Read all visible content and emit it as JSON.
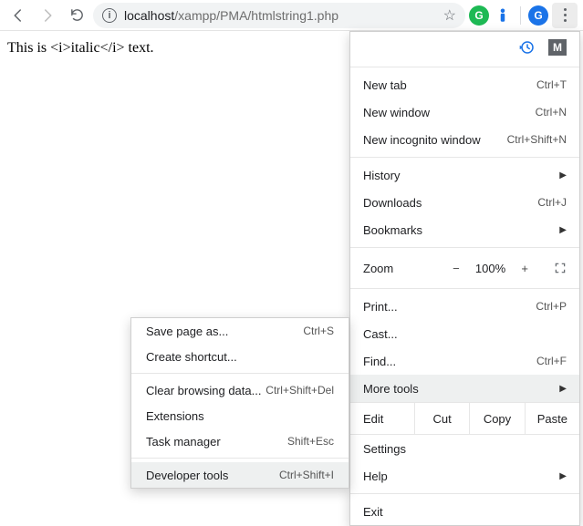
{
  "toolbar": {
    "url_host": "localhost",
    "url_path": "/xampp/PMA/htmlstring1.php",
    "profile_letter": "G"
  },
  "page": {
    "body_text": "This is <i>italic</i> text."
  },
  "menu": {
    "new_tab": "New tab",
    "new_tab_sc": "Ctrl+T",
    "new_window": "New window",
    "new_window_sc": "Ctrl+N",
    "incognito": "New incognito window",
    "incognito_sc": "Ctrl+Shift+N",
    "history": "History",
    "downloads": "Downloads",
    "downloads_sc": "Ctrl+J",
    "bookmarks": "Bookmarks",
    "zoom": "Zoom",
    "zoom_pct": "100%",
    "print": "Print...",
    "print_sc": "Ctrl+P",
    "cast": "Cast...",
    "find": "Find...",
    "find_sc": "Ctrl+F",
    "more_tools": "More tools",
    "edit": "Edit",
    "cut": "Cut",
    "copy": "Copy",
    "paste": "Paste",
    "settings": "Settings",
    "help": "Help",
    "exit": "Exit"
  },
  "submenu": {
    "save_as": "Save page as...",
    "save_as_sc": "Ctrl+S",
    "create_shortcut": "Create shortcut...",
    "clear_data": "Clear browsing data...",
    "clear_data_sc": "Ctrl+Shift+Del",
    "extensions": "Extensions",
    "task_manager": "Task manager",
    "task_manager_sc": "Shift+Esc",
    "devtools": "Developer tools",
    "devtools_sc": "Ctrl+Shift+I"
  }
}
